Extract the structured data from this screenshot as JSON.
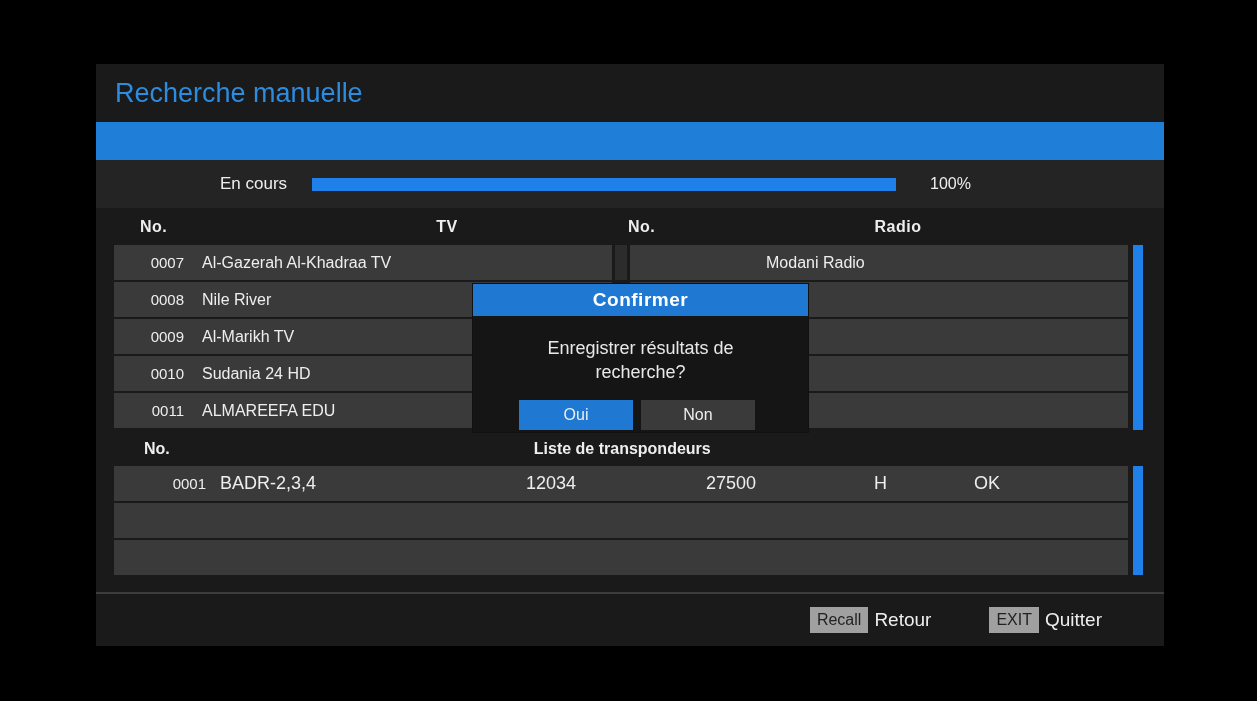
{
  "title": "Recherche manuelle",
  "progress": {
    "label": "En cours",
    "level": 1.0,
    "reading": "100%"
  },
  "tv": {
    "columns": [
      "No.",
      "TV"
    ],
    "rows": [
      {
        "no": "0007",
        "name": "Al-Gazerah Al-Khadraa TV"
      },
      {
        "no": "0008",
        "name": "Nile River"
      },
      {
        "no": "0009",
        "name": "Al-Marikh TV"
      },
      {
        "no": "0010",
        "name": "Sudania 24 HD"
      },
      {
        "no": "0011",
        "name": "ALMAREEFA EDU"
      }
    ]
  },
  "radio": {
    "columns": [
      "No.",
      "Radio"
    ],
    "rows": [
      {
        "name": "Modani Radio"
      }
    ]
  },
  "transponders": {
    "columns": [
      "No.",
      "Liste de transpondeurs"
    ],
    "rows": [
      {
        "no": "0001",
        "satellite": "BADR-2,3,4",
        "frequency": "12034",
        "symbol_rate": "27500",
        "polarization": "H",
        "status": "OK"
      }
    ]
  },
  "dialog": {
    "title": "Confirmer",
    "message": "Enregistrer résultats de recherche?",
    "buttons": [
      {
        "label": "Oui",
        "selected": true
      },
      {
        "label": "Non",
        "selected": false
      }
    ]
  },
  "footer": [
    {
      "key": "Recall",
      "action": "Retour"
    },
    {
      "key": "EXIT",
      "action": "Quitter"
    }
  ]
}
